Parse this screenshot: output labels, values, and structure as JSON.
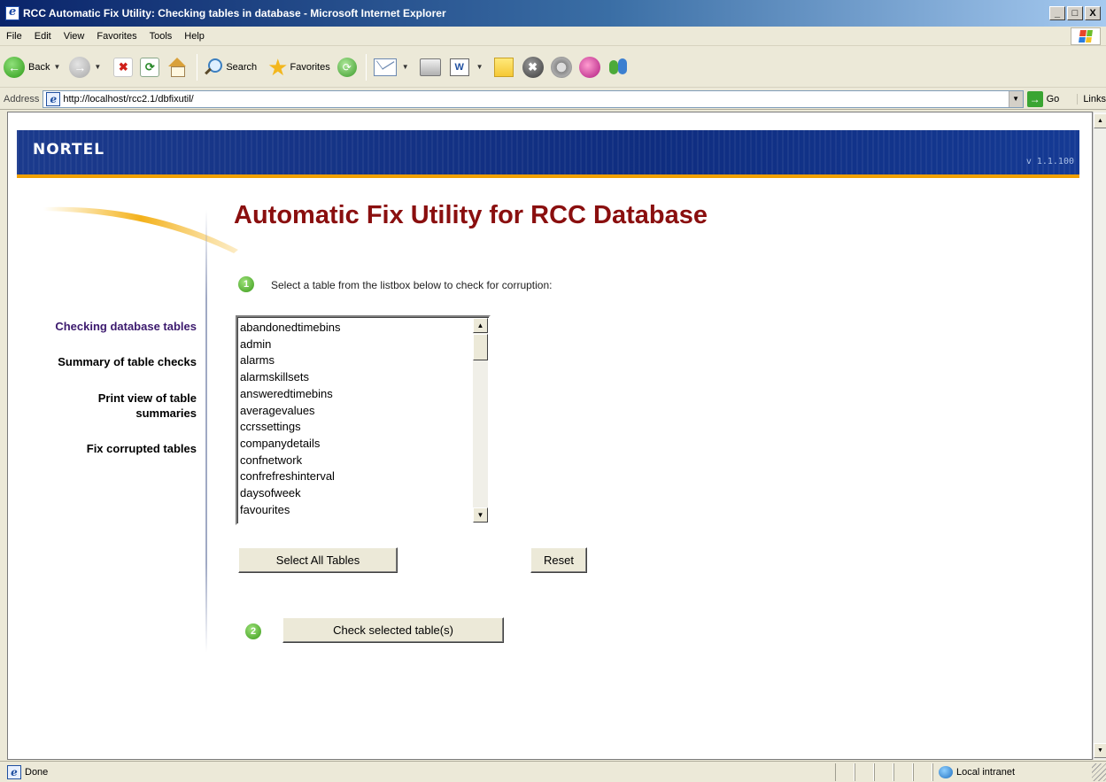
{
  "window": {
    "title": "RCC Automatic Fix Utility: Checking tables in database - Microsoft Internet Explorer",
    "min_glyph": "_",
    "max_glyph": "□",
    "close_glyph": "X"
  },
  "menu": {
    "items": [
      "File",
      "Edit",
      "View",
      "Favorites",
      "Tools",
      "Help"
    ]
  },
  "toolbar": {
    "back_label": "Back",
    "search_label": "Search",
    "favorites_label": "Favorites"
  },
  "address": {
    "label": "Address",
    "url": "http://localhost/rcc2.1/dbfixutil/",
    "go_label": "Go",
    "links_label": "Links"
  },
  "page": {
    "logo": "NORTEL",
    "version": "v 1.1.100",
    "heading": "Automatic Fix Utility for RCC Database",
    "nav": [
      {
        "label": "Checking database tables"
      },
      {
        "label": "Summary of table checks"
      },
      {
        "label": "Print view of table summaries"
      },
      {
        "label": "Fix corrupted tables"
      }
    ],
    "step1_number": "1",
    "step1_text": "Select a table from the listbox below to check for corruption:",
    "tables": [
      "abandonedtimebins",
      "admin",
      "alarms",
      "alarmskillsets",
      "answeredtimebins",
      "averagevalues",
      "ccrssettings",
      "companydetails",
      "confnetwork",
      "confrefreshinterval",
      "daysofweek",
      "favourites"
    ],
    "select_all_label": "Select All Tables",
    "reset_label": "Reset",
    "step2_number": "2",
    "check_label": "Check selected table(s)"
  },
  "status": {
    "text": "Done",
    "zone": "Local intranet"
  },
  "colors": {
    "heading": "#8a0f0f",
    "nav_active": "#3c1a6e",
    "banner": "#1b3a8c",
    "banner_stripe": "#f0a000"
  }
}
